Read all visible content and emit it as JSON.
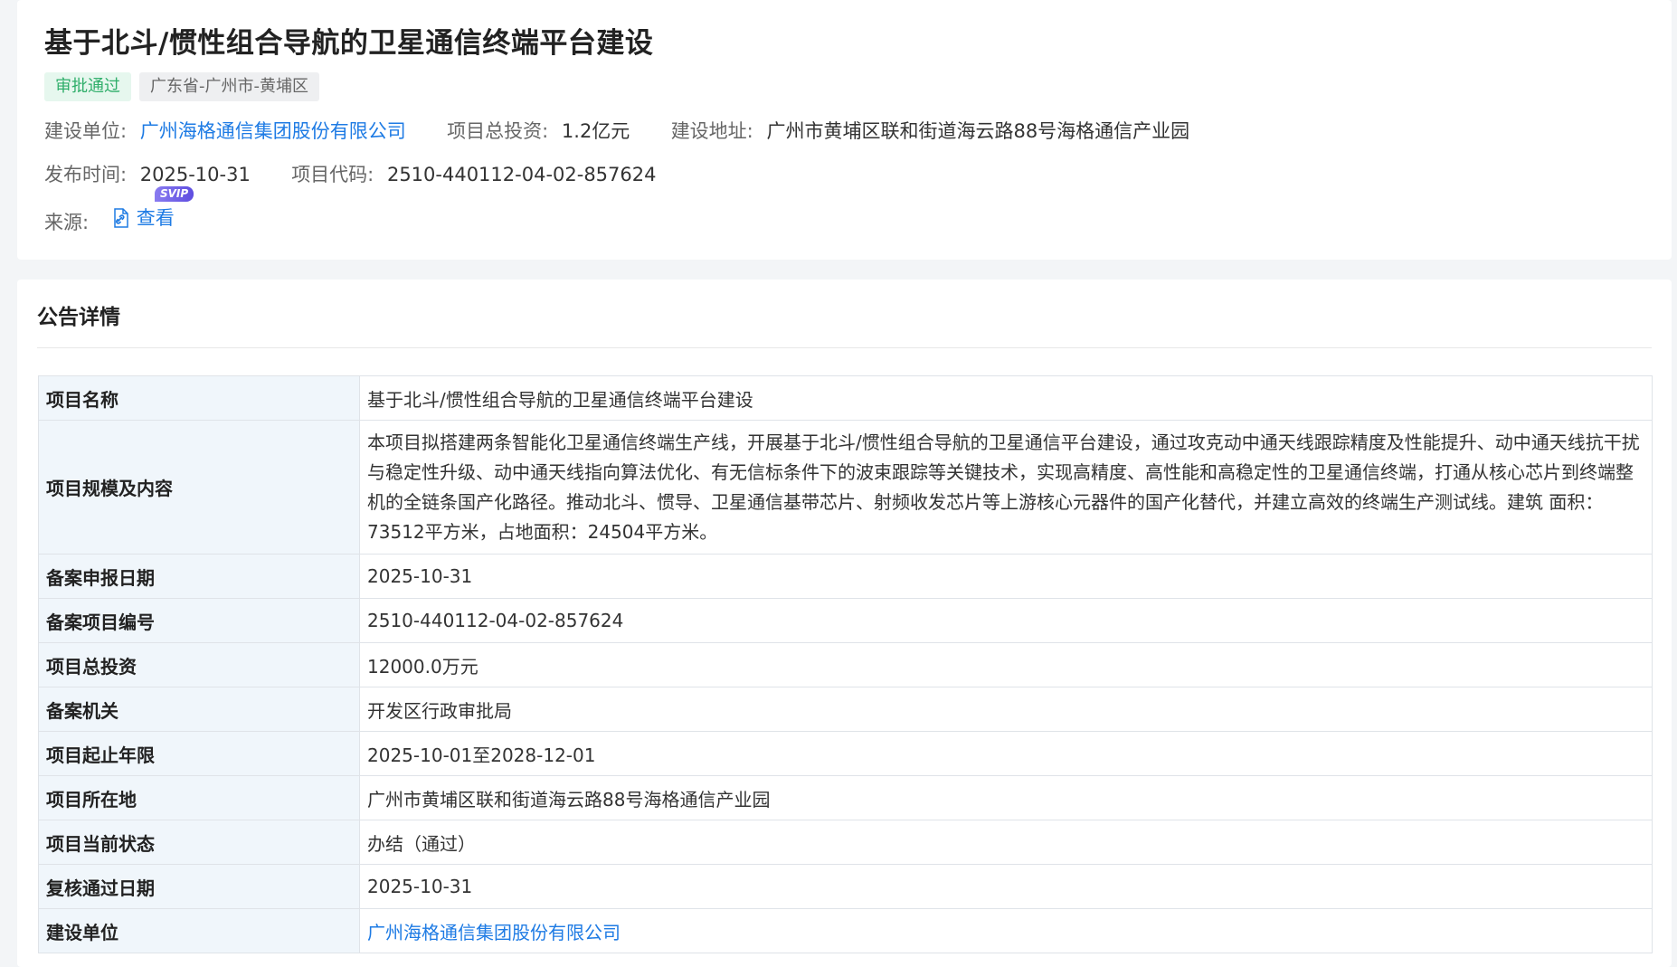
{
  "header": {
    "title": "基于北斗/惯性组合导航的卫星通信终端平台建设",
    "tags": {
      "status": "审批通过",
      "region": "广东省-广州市-黄埔区"
    },
    "meta": {
      "builder_label": "建设单位:",
      "builder_value": "广州海格通信集团股份有限公司",
      "investment_label": "项目总投资:",
      "investment_value": "1.2亿元",
      "address_label": "建设地址:",
      "address_value": "广州市黄埔区联和街道海云路88号海格通信产业园",
      "publish_label": "发布时间:",
      "publish_value": "2025-10-31",
      "code_label": "项目代码:",
      "code_value": "2510-440112-04-02-857624",
      "source_label": "来源:",
      "source_link": "查看",
      "svip_badge": "SVIP"
    }
  },
  "detail": {
    "section_title": "公告详情",
    "rows": [
      {
        "key": "项目名称",
        "value": "基于北斗/惯性组合导航的卫星通信终端平台建设"
      },
      {
        "key": "项目规模及内容",
        "value": "本项目拟搭建两条智能化卫星通信终端生产线，开展基于北斗/惯性组合导航的卫星通信平台建设，通过攻克动中通天线跟踪精度及性能提升、动中通天线抗干扰与稳定性升级、动中通天线指向算法优化、有无信标条件下的波束跟踪等关键技术，实现高精度、高性能和高稳定性的卫星通信终端，打通从核心芯片到终端整机的全链条国产化路径。推动北斗、惯导、卫星通信基带芯片、射频收发芯片等上游核心元器件的国产化替代，并建立高效的终端生产测试线。建筑 面积：73512平方米，占地面积：24504平方米。"
      },
      {
        "key": "备案申报日期",
        "value": "2025-10-31"
      },
      {
        "key": "备案项目编号",
        "value": "2510-440112-04-02-857624"
      },
      {
        "key": "项目总投资",
        "value": "12000.0万元"
      },
      {
        "key": "备案机关",
        "value": "开发区行政审批局"
      },
      {
        "key": "项目起止年限",
        "value": "2025-10-01至2028-12-01"
      },
      {
        "key": "项目所在地",
        "value": "广州市黄埔区联和街道海云路88号海格通信产业园"
      },
      {
        "key": "项目当前状态",
        "value": "办结（通过）"
      },
      {
        "key": "复核通过日期",
        "value": "2025-10-31"
      },
      {
        "key": "建设单位",
        "value": "广州海格通信集团股份有限公司"
      }
    ]
  },
  "colors": {
    "accent": "#1e7be4",
    "status_green": "#2fae6a",
    "table_key_bg": "#f0f6fb"
  }
}
